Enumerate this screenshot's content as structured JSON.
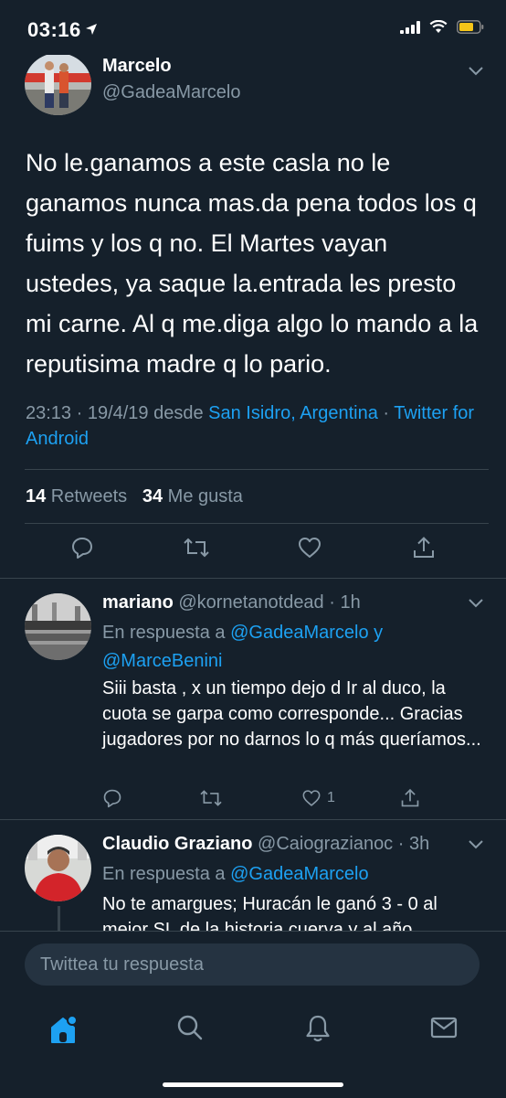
{
  "status_bar": {
    "time": "03:16",
    "battery_color": "#f5c518"
  },
  "main_tweet": {
    "name": "Marcelo",
    "handle": "@GadeaMarcelo",
    "text": "No le.ganamos a este casla no le ganamos nunca mas.da pena todos los q fuims y los q no. El Martes vayan ustedes, ya saque la.entrada les presto mi carne. Al q me.diga algo lo mando a la reputisima madre q lo pario.",
    "time_date": "23:13 · 19/4/19 desde ",
    "location": "San Isidro, Argentina",
    "separator": " · ",
    "client": "Twitter for Android",
    "retweets_count": "14",
    "retweets_label": " Retweets",
    "likes_count": "34",
    "likes_label": " Me gusta"
  },
  "replies": [
    {
      "name": "mariano",
      "handle": "@kornetanotdead",
      "time": " · 1h",
      "reply_to_prefix": "En respuesta a ",
      "reply_to_1": "@GadeaMarcelo",
      "reply_to_join": " y",
      "reply_to_2": "@MarceBenini",
      "text": "Siii basta , x un tiempo dejo d Ir al duco, la cuota se garpa como corresponde... Gracias jugadores por no darnos lo q más queríamos...",
      "like_count": "1"
    },
    {
      "name": "Claudio Graziano",
      "handle": "@Caiograzianoc",
      "time": " · 3h",
      "reply_to_prefix": "En respuesta a ",
      "reply_to_1": "@GadeaMarcelo",
      "text": "No te amargues; Huracán le ganó 3 - 0 al mejor SL de la historia cuerva y al año"
    }
  ],
  "compose": {
    "placeholder": "Twittea tu respuesta"
  },
  "colors": {
    "background": "#15202b",
    "accent": "#1da1f2",
    "muted": "#8899a6",
    "divider": "#38444d"
  },
  "tabs": [
    "home-icon",
    "search-icon",
    "notifications-icon",
    "messages-icon"
  ]
}
